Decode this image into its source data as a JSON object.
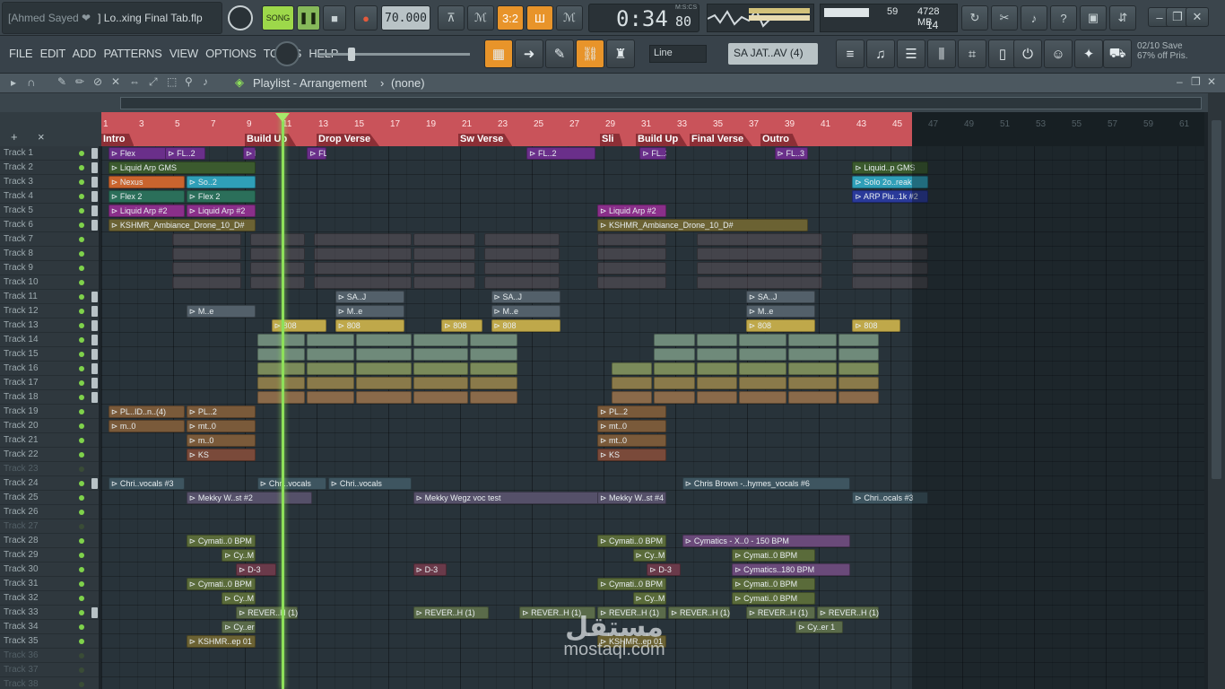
{
  "title_bar": {
    "user": "[Ahmed Sayed ❤",
    "file": "] Lo..xing Final Tab.flp"
  },
  "transport": {
    "song": "SONG",
    "tempo": "70.000",
    "time": "0:34",
    "time_sub": "80",
    "time_unit": "M:S:CS",
    "pat_label": "3:2",
    "cpu_val": "59",
    "mem": "4728 MB",
    "voices": "14"
  },
  "menu": [
    "FILE",
    "EDIT",
    "ADD",
    "PATTERNS",
    "VIEW",
    "OPTIONS",
    "TOOLS",
    "HELP"
  ],
  "toolbar": {
    "snap": "Line",
    "pattern": "SA JAT..AV (4)",
    "news": "02/10  Save",
    "news2": "67% off Pris."
  },
  "playlist": {
    "title": "Playlist - Arrangement",
    "sep": "›",
    "pattern": "(none)"
  },
  "tracks": [
    "Track 1",
    "Track 2",
    "Track 3",
    "Track 4",
    "Track 5",
    "Track 6",
    "Track 7",
    "Track 8",
    "Track 9",
    "Track 10",
    "Track 11",
    "Track 12",
    "Track 13",
    "Track 14",
    "Track 15",
    "Track 16",
    "Track 17",
    "Track 18",
    "Track 19",
    "Track 20",
    "Track 21",
    "Track 22",
    "Track 23",
    "Track 24",
    "Track 25",
    "Track 26",
    "Track 27",
    "Track 28",
    "Track 29",
    "Track 30",
    "Track 31",
    "Track 32",
    "Track 33",
    "Track 34",
    "Track 35",
    "Track 36",
    "Track 37",
    "Track 38"
  ],
  "dim_tracks": [
    23,
    27,
    36,
    37,
    38
  ],
  "bars": [
    "1",
    "3",
    "5",
    "7",
    "9",
    "11",
    "13",
    "15",
    "17",
    "19",
    "21",
    "23",
    "25",
    "27",
    "29",
    "31",
    "33",
    "35",
    "37",
    "39",
    "41",
    "43",
    "45",
    "47",
    "49",
    "51",
    "53",
    "55",
    "57",
    "59",
    "61"
  ],
  "markers": [
    "Intro",
    "Build Up",
    "Drop Verse",
    "Sw Verse",
    "Sli",
    "Build Up",
    "Final Verse",
    "Outro"
  ],
  "clips": [
    [
      "Flex",
      "#6a2f8a",
      0,
      1,
      10
    ],
    [
      "FL..2",
      "#6a2f8a",
      0,
      9,
      15
    ],
    [
      "FL..3",
      "#6a2f8a",
      0,
      20,
      22
    ],
    [
      "FL..3",
      "#6a2f8a",
      0,
      29,
      32
    ],
    [
      "FL..2",
      "#6a2f8a",
      0,
      60,
      70
    ],
    [
      "FL..3",
      "#6a2f8a",
      0,
      76,
      80
    ],
    [
      "FL..3",
      "#6a2f8a",
      0,
      95,
      100
    ],
    [
      "Liquid Arp GMS",
      "#3b5a2e",
      1,
      1,
      22
    ],
    [
      "Liquid..p GMS",
      "#3b5a2e",
      1,
      106,
      117
    ],
    [
      "Nexus",
      "#c9642e",
      2,
      1,
      12
    ],
    [
      "So..2",
      "#2f9fb8",
      2,
      12,
      22
    ],
    [
      "Solo 2o..reak",
      "#2f9fb8",
      2,
      106,
      117
    ],
    [
      "Flex 2",
      "#2b6f5a",
      3,
      1,
      12
    ],
    [
      "Flex 2",
      "#2b6f5a",
      3,
      12,
      22
    ],
    [
      "ARP Plu..1k #2",
      "#2a3a9a",
      3,
      106,
      117
    ],
    [
      "Liquid Arp #2",
      "#8a2f8a",
      4,
      1,
      12
    ],
    [
      "Liquid Arp #2",
      "#8a2f8a",
      4,
      12,
      22
    ],
    [
      "Liquid Arp #2",
      "#8a2f8a",
      4,
      70,
      80
    ],
    [
      "KSHMR_Ambiance_Drone_10_D#",
      "#6b6233",
      5,
      1,
      22
    ],
    [
      "KSHMR_Ambiance_Drone_10_D#",
      "#6b6233",
      5,
      70,
      100
    ],
    [
      "M..e",
      "#53606a",
      11,
      12,
      22
    ],
    [
      "SA..J",
      "#53606a",
      10,
      33,
      43
    ],
    [
      "M..e",
      "#53606a",
      11,
      33,
      43
    ],
    [
      "SA..J",
      "#53606a",
      10,
      55,
      65
    ],
    [
      "M..e",
      "#53606a",
      11,
      55,
      65
    ],
    [
      "SA..J",
      "#53606a",
      10,
      91,
      101
    ],
    [
      "M..e",
      "#53606a",
      11,
      91,
      101
    ],
    [
      "808",
      "#bfa84a",
      12,
      24,
      32
    ],
    [
      "808",
      "#bfa84a",
      12,
      33,
      43
    ],
    [
      "808",
      "#bfa84a",
      12,
      48,
      54
    ],
    [
      "808",
      "#bfa84a",
      12,
      55,
      65
    ],
    [
      "808",
      "#bfa84a",
      12,
      91,
      101
    ],
    [
      "808",
      "#bfa84a",
      12,
      106,
      113
    ],
    [
      "PL..ID..n..(4)",
      "#7a5a3a",
      18,
      1,
      12
    ],
    [
      "PL..2",
      "#7a5a3a",
      18,
      12,
      22
    ],
    [
      "PL..2",
      "#7a5a3a",
      18,
      70,
      80
    ],
    [
      "m..0",
      "#7a5a3a",
      19,
      1,
      12
    ],
    [
      "mt..0",
      "#7a5a3a",
      19,
      12,
      22
    ],
    [
      "mt..0",
      "#7a5a3a",
      19,
      70,
      80
    ],
    [
      "m..0",
      "#7a5a3a",
      20,
      12,
      22
    ],
    [
      "mt..0",
      "#7a5a3a",
      20,
      70,
      80
    ],
    [
      "KS",
      "#7a4a3a",
      21,
      12,
      22
    ],
    [
      "KS",
      "#7a4a3a",
      21,
      70,
      80
    ],
    [
      "Chri..vocals #3",
      "#3e5560",
      23,
      1,
      12
    ],
    [
      "Chri..vocals",
      "#3e5560",
      23,
      22,
      32
    ],
    [
      "Chri..vocals",
      "#3e5560",
      23,
      32,
      44
    ],
    [
      "Chris Brown -..hymes_vocals #6",
      "#3e5560",
      23,
      82,
      106
    ],
    [
      "Mekky W..st #2",
      "#555069",
      24,
      12,
      30
    ],
    [
      "Mekky Wegz voc test",
      "#555069",
      24,
      44,
      71
    ],
    [
      "Mekky W..st #4",
      "#555069",
      24,
      70,
      80
    ],
    [
      "Chri..ocals #3",
      "#3e5560",
      24,
      106,
      117
    ],
    [
      "Cymati..0 BPM",
      "#5a6b3a",
      27,
      12,
      22
    ],
    [
      "Cymati..0 BPM",
      "#5a6b3a",
      27,
      70,
      80
    ],
    [
      "Cymatics - X..0 - 150 BPM",
      "#6a4a7a",
      27,
      82,
      106
    ],
    [
      "Cy..M",
      "#5a6b3a",
      28,
      17,
      22
    ],
    [
      "Cy..M",
      "#5a6b3a",
      28,
      75,
      80
    ],
    [
      "Cymati..0 BPM",
      "#5a6b3a",
      28,
      89,
      101
    ],
    [
      "D-3",
      "#6a3a4a",
      29,
      19,
      25
    ],
    [
      "D-3",
      "#6a3a4a",
      29,
      44,
      49
    ],
    [
      "D-3",
      "#6a3a4a",
      29,
      77,
      82
    ],
    [
      "Cymatics..180 BPM",
      "#6a4a7a",
      29,
      89,
      106
    ],
    [
      "Cymati..0 BPM",
      "#5a6b3a",
      30,
      12,
      22
    ],
    [
      "Cymati..0 BPM",
      "#5a6b3a",
      30,
      70,
      80
    ],
    [
      "Cymati..0 BPM",
      "#5a6b3a",
      30,
      89,
      101
    ],
    [
      "Cy..M",
      "#5a6b3a",
      31,
      17,
      22
    ],
    [
      "Cy..M",
      "#5a6b3a",
      31,
      75,
      80
    ],
    [
      "Cymati..0 BPM",
      "#5a6b3a",
      31,
      89,
      101
    ],
    [
      "REVER..H (1)",
      "#5a6b4a",
      32,
      19,
      28
    ],
    [
      "REVER..H (1)",
      "#5a6b4a",
      32,
      44,
      55
    ],
    [
      "REVER..H (1)",
      "#5a6b4a",
      32,
      59,
      70
    ],
    [
      "REVER..H (1)",
      "#5a6b4a",
      32,
      70,
      80
    ],
    [
      "REVER..H (1)",
      "#5a6b4a",
      32,
      80,
      89
    ],
    [
      "REVER..H (1)",
      "#5a6b4a",
      32,
      91,
      101
    ],
    [
      "REVER..H (1)",
      "#5a6b4a",
      32,
      101,
      110
    ],
    [
      "Cy..er 1",
      "#5a6b4a",
      33,
      17,
      22
    ],
    [
      "Cy..er 1",
      "#5a6b4a",
      33,
      98,
      105
    ],
    [
      "KSHMR..ep 01",
      "#6b6233",
      34,
      12,
      22
    ],
    [
      "KSHMR..ep 01",
      "#6b6233",
      34,
      70,
      80
    ]
  ]
}
